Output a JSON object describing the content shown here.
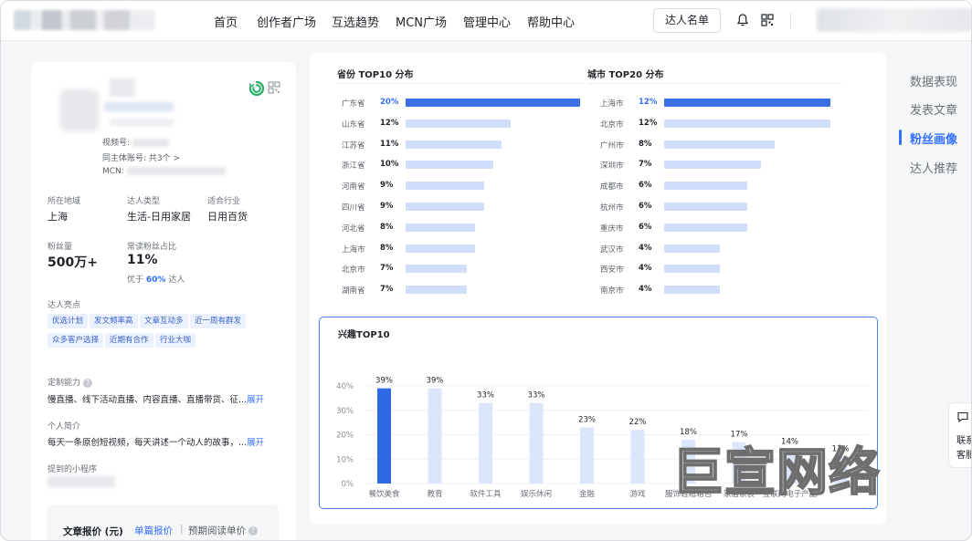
{
  "nav": {
    "items": [
      "首页",
      "创作者广场",
      "互选趋势",
      "MCN广场",
      "管理中心",
      "帮助中心"
    ],
    "talent_list_button": "达人名单"
  },
  "profile": {
    "channel_label": "视频号:",
    "same_account_label": "同主体账号:",
    "same_account_count": "共3个 >",
    "mcn_label": "MCN:",
    "region_label": "所在地域",
    "region_value": "上海",
    "type_label": "达人类型",
    "type_value": "生活-日用家居",
    "industry_label": "适合行业",
    "industry_value": "日用百货",
    "fans_label": "粉丝量",
    "fans_value": "500万+",
    "ratio_label": "常读粉丝占比",
    "ratio_value": "11%",
    "ratio_note_prefix": "优于",
    "ratio_note_pct": "60%",
    "ratio_note_suffix": "达人",
    "highlights_label": "达人亮点",
    "tags": [
      "优选计划",
      "发文频率高",
      "文章互动多",
      "近一周有群发",
      "众多客户选择",
      "近期有合作",
      "行业大咖"
    ],
    "custom_label": "定制能力",
    "custom_text": "慢直播、线下活动直播、内容直播、直播带货、征...",
    "intro_label": "个人简介",
    "intro_text": "每天一条原创短视频，每天讲述一个动人的故事，...",
    "more_label": "展开",
    "mini_program_label": "提到的小程序",
    "quote_title": "文章报价 (元)",
    "quote_tab_single": "单篇报价",
    "quote_tab_sep": "|",
    "quote_tab_read": "预期阅读单价"
  },
  "province": {
    "title": "省份 TOP10 分布",
    "rows": [
      {
        "name": "广东省",
        "pct": 20
      },
      {
        "name": "山东省",
        "pct": 12
      },
      {
        "name": "江苏省",
        "pct": 11
      },
      {
        "name": "浙江省",
        "pct": 10
      },
      {
        "name": "河南省",
        "pct": 9
      },
      {
        "name": "四川省",
        "pct": 9
      },
      {
        "name": "河北省",
        "pct": 8
      },
      {
        "name": "上海市",
        "pct": 8
      },
      {
        "name": "北京市",
        "pct": 7
      },
      {
        "name": "湖南省",
        "pct": 7
      }
    ]
  },
  "city": {
    "title": "城市 TOP20 分布",
    "rows": [
      {
        "name": "上海市",
        "pct": 12
      },
      {
        "name": "北京市",
        "pct": 12
      },
      {
        "name": "广州市",
        "pct": 8
      },
      {
        "name": "深圳市",
        "pct": 7
      },
      {
        "name": "成都市",
        "pct": 6
      },
      {
        "name": "杭州市",
        "pct": 6
      },
      {
        "name": "重庆市",
        "pct": 6
      },
      {
        "name": "武汉市",
        "pct": 4
      },
      {
        "name": "西安市",
        "pct": 4
      },
      {
        "name": "南京市",
        "pct": 4
      }
    ]
  },
  "chart_data": {
    "type": "bar",
    "title": "兴趣TOP10",
    "categories": [
      "餐饮美食",
      "教育",
      "软件工具",
      "娱乐休闲",
      "金融",
      "游戏",
      "服饰鞋帽箱包",
      "家居家装",
      "互联网电子产品",
      ""
    ],
    "values": [
      39,
      39,
      33,
      33,
      23,
      22,
      18,
      17,
      14,
      11
    ],
    "value_labels": [
      "39%",
      "39%",
      "33%",
      "33%",
      "23%",
      "22%",
      "18%",
      "17%",
      "14%",
      "11%"
    ],
    "yticks": [
      "0%",
      "10%",
      "20%",
      "30%",
      "40%"
    ],
    "ylim": [
      0,
      40
    ],
    "xlabel": "",
    "ylabel": "",
    "highlight_index": 0,
    "colors": {
      "highlight": "#2f6ae6",
      "normal": "#dce6fb"
    }
  },
  "side_nav": {
    "items": [
      "数据表现",
      "发表文章",
      "粉丝画像",
      "达人推荐"
    ],
    "active_index": 2
  },
  "contact": {
    "line1": "联系",
    "line2": "客服"
  },
  "watermark": "巨宣网络"
}
